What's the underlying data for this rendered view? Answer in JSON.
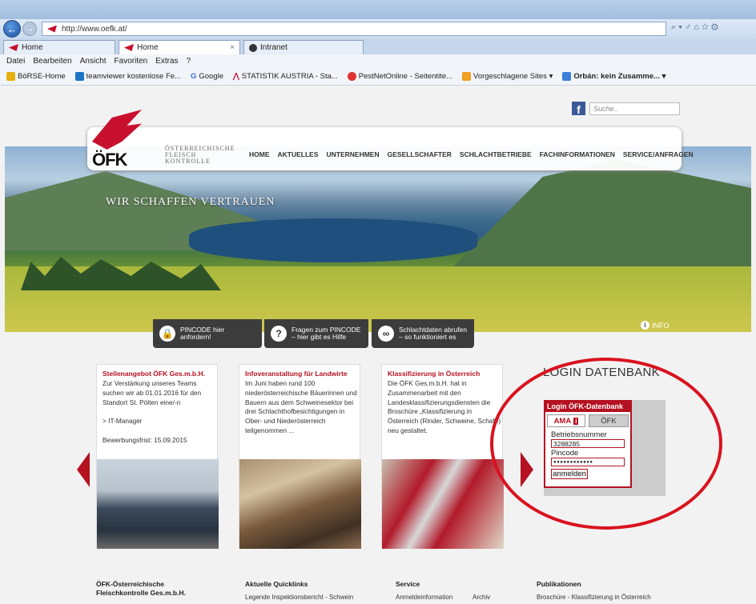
{
  "browser": {
    "url": "http://www.oefk.at/",
    "tabs": [
      {
        "label": "Home"
      },
      {
        "label": "Home"
      },
      {
        "label": "Intranet"
      }
    ],
    "menu": [
      "Datei",
      "Bearbeiten",
      "Ansicht",
      "Favoriten",
      "Extras",
      "?"
    ],
    "favorites": [
      "BöRSE-Home",
      "teamviewer kostenlose Fe...",
      "Google",
      "STATISTIK AUSTRIA - Sta...",
      "PestNetOnline - Seitentite...",
      "Vorgeschlagene Sites ▾",
      "Orbán: kein Zusamme... ▾"
    ],
    "tool_icons": "⌕ ▾ ♂   ⌂ ☆ ⚙"
  },
  "site": {
    "search_placeholder": "Suche..",
    "logo": "ÖFK",
    "logo_sub": [
      "ÖSTERREICHISCHE",
      "FLEISCH",
      "KONTROLLE"
    ],
    "nav": [
      "HOME",
      "AKTUELLES",
      "UNTERNEHMEN",
      "GESELLSCHAFTER",
      "SCHLACHTBETRIEBE",
      "FACHINFORMATIONEN",
      "SERVICE/ANFRAGEN"
    ],
    "hero_text": "WIR SCHAFFEN VERTRAUEN",
    "pin_buttons": [
      {
        "text": "PINCODE hier anfordern!",
        "icon": "lock-icon"
      },
      {
        "text": "Fragen zum PINCODE – hier gibt es Hilfe",
        "icon": "question-icon"
      },
      {
        "text": "Schlachtdaten abrufen – so funktioniert es",
        "icon": "binoculars-icon"
      }
    ],
    "info": "INFO",
    "cards": [
      {
        "title": "Stellenangebot ÖFK Ges.m.b.H.",
        "body": "Zur Verstärkung unseres Teams suchen wir ab 01.01.2016 für den Standort St. Pölten eine/-n\n\n> IT-Manager\n\nBewerbungsfrist: 15.09.2015"
      },
      {
        "title": "Infoveranstaltung für Landwirte",
        "body": "Im Juni haben rund 100 niederösterreichische Bäuerinnen und Bauern aus dem Schweinesektor bei drei Schlachthofbesichtigungen in Ober- und Niederösterreich teilgenommen ..."
      },
      {
        "title": "Klassifizierung in Österreich",
        "body": "Die ÖFK Ges.m.b.H. hat in Zusammenarbeit mit den Landesklassifizierungsdiensten die Broschüre „Klassifizierung in Österreich (Rinder, Schweine, Schafe) neu gestaltet."
      }
    ],
    "login": {
      "title": "LOGIN DATENBANK",
      "box_title": "Login ÖFK-Datenbank",
      "tab_ama": "AMA",
      "tab_oefk": "ÖFK",
      "label_betrieb": "Betriebsnummer",
      "value_betrieb": "3288285",
      "label_pin": "Pincode",
      "value_pin": "●●●●●●●●●●●●",
      "button": "anmelden"
    },
    "footer": [
      {
        "head": "ÖFK-Österreichische Fleischkontrolle Ges.m.b.H.",
        "text": ""
      },
      {
        "head": "Aktuelle Quicklinks",
        "text": "Legende Inspektionsbericht - Schwein"
      },
      {
        "head": "Service",
        "text": "Anmeldeinformation"
      },
      {
        "head": "",
        "text": "Archiv"
      },
      {
        "head": "Publikationen",
        "text": "Broschüre - Klassifizierung in Österreich"
      }
    ]
  }
}
